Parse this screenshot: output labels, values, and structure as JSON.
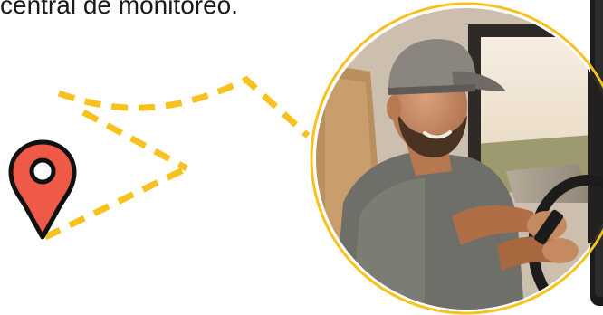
{
  "headline": {
    "text": "central de monitoreo."
  },
  "colors": {
    "accent_yellow": "#f7c21f",
    "pin_red": "#ef5a48",
    "pin_outline": "#111111",
    "text": "#1a1a1a"
  },
  "icons": {
    "location_pin": "map-pin-icon"
  }
}
